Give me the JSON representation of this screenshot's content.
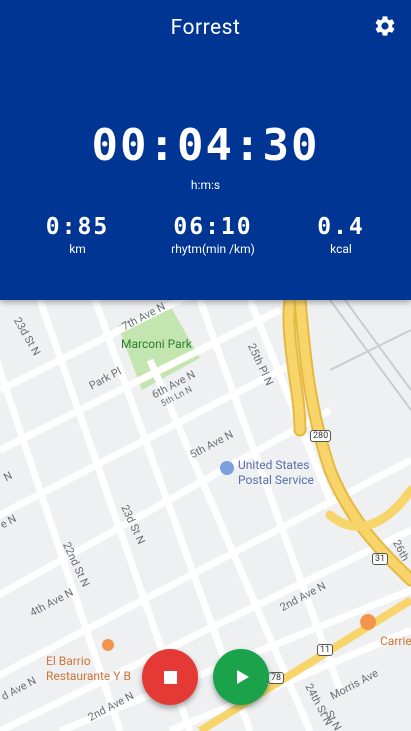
{
  "app": {
    "title": "Forrest"
  },
  "icons": {
    "settings": "gear-icon",
    "stop": "stop-icon",
    "play": "play-icon",
    "place": "map-pin-icon",
    "food": "restaurant-icon"
  },
  "timer": {
    "value": "00:04:30",
    "unit": "h:m:s"
  },
  "stats": {
    "distance": {
      "value": "0:85",
      "label": "km"
    },
    "rhythm": {
      "value": "06:10",
      "label": "rhytm(min /km)"
    },
    "calories": {
      "value": "0.4",
      "label": "kcal"
    }
  },
  "map": {
    "park": "Marconi Park",
    "poi_post": "United States\nPostal Service",
    "poi_restaurant": "El Barrio\nRestaurante Y B",
    "poi_carrie": "Carrie",
    "streets": {
      "s23": "23d St N",
      "park_pl": "Park Pl",
      "ave6": "6th Ave N",
      "ave5a": "5th Ln N",
      "ave5": "5th Ave N",
      "st25": "25th Pl N",
      "st23b": "23d St N",
      "st22": "22nd St N",
      "ave4": "4th Ave N",
      "ave2": "2nd Ave N",
      "ave2b": "2nd Ave N",
      "st24": "24th St N",
      "morris": "Morris Ave",
      "ave7": "7th Ave N",
      "st26": "26th",
      "st_n": "St N",
      "ave_left": "N",
      "ave_left2": "e N",
      "ave_left3": "d Ave N"
    },
    "shields": {
      "i280": "280",
      "i31": "31",
      "i11": "11",
      "i78": "78"
    }
  },
  "colors": {
    "header": "#003593",
    "stop": "#e53935",
    "play": "#1aa34a",
    "highway": "#f7d56b",
    "park": "#c3e6b0"
  }
}
